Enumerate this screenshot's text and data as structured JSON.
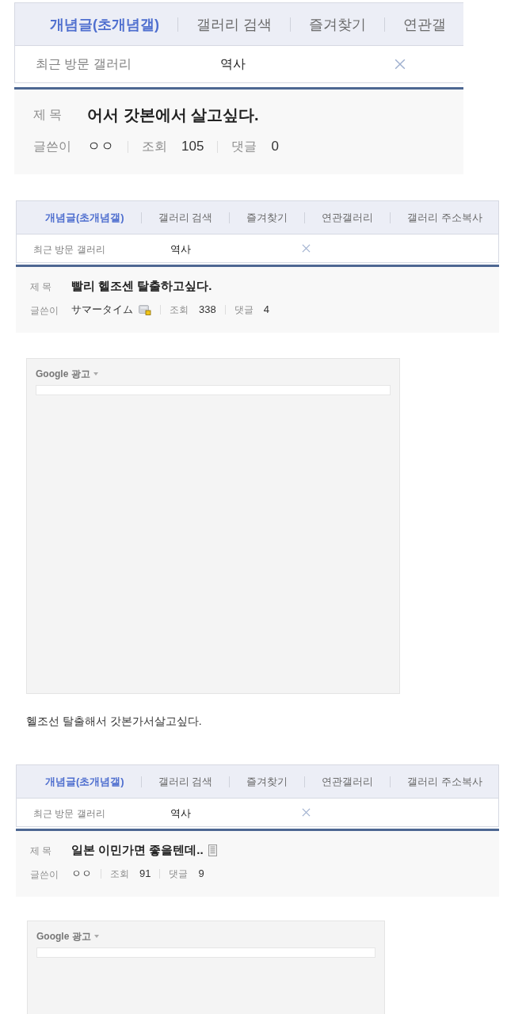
{
  "captures": [
    {
      "kind": "closeup",
      "tabs": [
        {
          "label": "개념글(초개념갤)",
          "selected": true
        },
        {
          "label": "갤러리 검색",
          "selected": false
        },
        {
          "label": "즐겨찾기",
          "selected": false
        },
        {
          "label": "연관갤",
          "selected": false
        }
      ],
      "recent": {
        "label": "최근 방문 갤러리",
        "gallery": "역사"
      },
      "post": {
        "title_label": "제 목",
        "title": "어서 갓본에서 살고싶다.",
        "title_icon": false,
        "author_label": "글쓴이",
        "author": "ㅇㅇ",
        "author_badge": false,
        "views_label": "조회",
        "views": "105",
        "comments_label": "댓글",
        "comments": "0"
      }
    },
    {
      "kind": "header",
      "tabs": [
        {
          "label": "개념글(초개념갤)",
          "selected": true
        },
        {
          "label": "갤러리 검색",
          "selected": false
        },
        {
          "label": "즐겨찾기",
          "selected": false
        },
        {
          "label": "연관갤러리",
          "selected": false
        },
        {
          "label": "갤러리 주소복사",
          "selected": false
        }
      ],
      "recent": {
        "label": "최근 방문 갤러리",
        "gallery": "역사"
      },
      "post": {
        "title_label": "제 목",
        "title": "빨리 헬조센 탈출하고싶다.",
        "title_icon": false,
        "author_label": "글쓴이",
        "author": "サマータイム",
        "author_badge": true,
        "views_label": "조회",
        "views": "338",
        "comments_label": "댓글",
        "comments": "4"
      }
    },
    {
      "kind": "ad",
      "label": "Google 광고"
    },
    {
      "kind": "text",
      "text": "헬조선 탈출해서 갓본가서살고싶다."
    },
    {
      "kind": "header",
      "tabs": [
        {
          "label": "개념글(초개념갤)",
          "selected": true
        },
        {
          "label": "갤러리 검색",
          "selected": false
        },
        {
          "label": "즐겨찾기",
          "selected": false
        },
        {
          "label": "연관갤러리",
          "selected": false
        },
        {
          "label": "갤러리 주소복사",
          "selected": false
        }
      ],
      "recent": {
        "label": "최근 방문 갤러리",
        "gallery": "역사"
      },
      "post": {
        "title_label": "제 목",
        "title": "일본 이민가면 좋을텐데..",
        "title_icon": true,
        "author_label": "글쓴이",
        "author": "ㅇㅇ",
        "author_badge": false,
        "views_label": "조회",
        "views": "91",
        "comments_label": "댓글",
        "comments": "9"
      }
    },
    {
      "kind": "ad",
      "label": "Google 광고"
    }
  ]
}
